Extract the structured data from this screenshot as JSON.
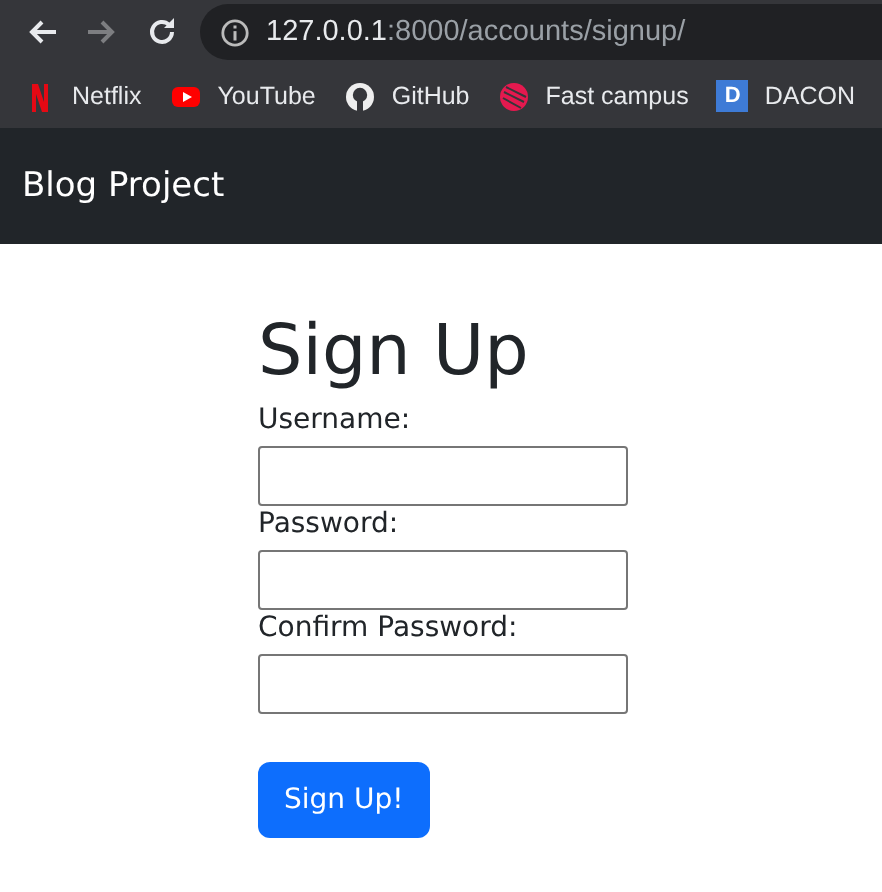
{
  "browser": {
    "nav": [
      {
        "kind": "back",
        "disabled": false
      },
      {
        "kind": "forward",
        "disabled": true
      },
      {
        "kind": "reload",
        "disabled": false
      }
    ],
    "url_host": "127.0.0.1",
    "url_path": ":8000/accounts/signup/",
    "bookmarks": [
      {
        "kind": "netflix",
        "label": "Netflix"
      },
      {
        "kind": "youtube",
        "label": "YouTube"
      },
      {
        "kind": "github",
        "label": "GitHub"
      },
      {
        "kind": "fastcampus",
        "label": "Fast campus"
      },
      {
        "kind": "dacon",
        "glyph": "D",
        "label": "DACON"
      }
    ]
  },
  "navbar": {
    "brand": "Blog Project"
  },
  "form": {
    "title": "Sign Up",
    "fields": [
      {
        "label": "Username:"
      },
      {
        "label": "Password:"
      },
      {
        "label": "Confirm Password:"
      }
    ],
    "submit": "Sign Up!"
  }
}
